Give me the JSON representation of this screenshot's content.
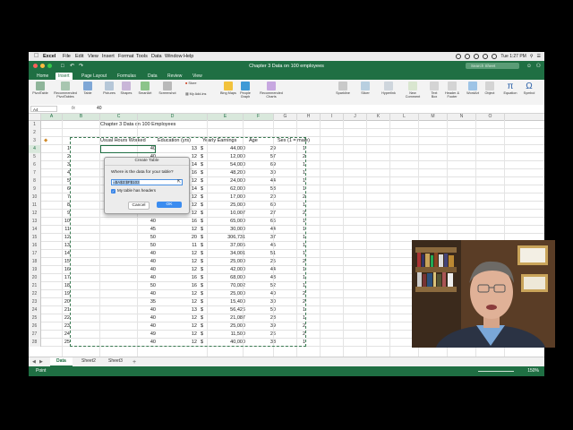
{
  "menubar": {
    "app": "Excel",
    "items": [
      "File",
      "Edit",
      "View",
      "Insert",
      "Format",
      "Tools",
      "Data",
      "Window",
      "Help"
    ],
    "clock": "Tue 1:27 PM"
  },
  "window": {
    "title": "Chapter 3 Data on 100 employees",
    "search_placeholder": "Search Sheet"
  },
  "ribbon_tabs": [
    "Home",
    "Insert",
    "Page Layout",
    "Formulas",
    "Data",
    "Review",
    "View"
  ],
  "ribbon_buttons": [
    "PivotTable",
    "Recommended PivotTables",
    "Table",
    "Pictures",
    "Shapes",
    "SmartArt",
    "Screenshot",
    "Store",
    "My Add-ins",
    "Bing Maps",
    "People Graph",
    "Recommended Charts",
    "Sparkline",
    "Slicer",
    "Hyperlink",
    "New Comment",
    "Text Box",
    "Header & Footer",
    "WordArt",
    "Object",
    "Equation",
    "Symbol"
  ],
  "formula_bar": {
    "name_box": "A4",
    "fx": "fx",
    "value": "40"
  },
  "columns": [
    "A",
    "B",
    "C",
    "D",
    "E",
    "F",
    "G",
    "H",
    "I",
    "J",
    "K",
    "L",
    "M",
    "N",
    "O"
  ],
  "sheet_title": "Chapter 3 Data on 100 Employees",
  "headers": {
    "hours": "Usual Hours Worked",
    "edu": "Education (yrs)",
    "earn": "Yearly Earnings",
    "age": "Age",
    "sex": "Sex (1 = male)"
  },
  "rows": [
    {
      "r": "4",
      "id": "1",
      "hours": "40",
      "edu": "13",
      "earn": "44,000",
      "age": "29",
      "sex": "1"
    },
    {
      "r": "5",
      "id": "2",
      "hours": "40",
      "edu": "12",
      "earn": "12,000",
      "age": "57",
      "sex": "2"
    },
    {
      "r": "6",
      "id": "3",
      "hours": "60",
      "edu": "14",
      "earn": "54,000",
      "age": "69",
      "sex": "1"
    },
    {
      "r": "7",
      "id": "4",
      "hours": "50",
      "edu": "16",
      "earn": "48,200",
      "age": "30",
      "sex": "1"
    },
    {
      "r": "8",
      "id": "5",
      "hours": "40",
      "edu": "12",
      "earn": "24,000",
      "age": "44",
      "sex": "1"
    },
    {
      "r": "9",
      "id": "6",
      "hours": "40",
      "edu": "14",
      "earn": "62,000",
      "age": "53",
      "sex": "1"
    },
    {
      "r": "10",
      "id": "7",
      "hours": "40",
      "edu": "12",
      "earn": "17,000",
      "age": "20",
      "sex": "2"
    },
    {
      "r": "11",
      "id": "8",
      "hours": "40",
      "edu": "12",
      "earn": "25,000",
      "age": "60",
      "sex": "1"
    },
    {
      "r": "12",
      "id": "9",
      "hours": "40",
      "edu": "12",
      "earn": "10,007",
      "age": "27",
      "sex": "2"
    },
    {
      "r": "13",
      "id": "10",
      "hours": "40",
      "edu": "16",
      "earn": "65,000",
      "age": "66",
      "sex": "1"
    },
    {
      "r": "14",
      "id": "11",
      "hours": "45",
      "edu": "12",
      "earn": "30,000",
      "age": "44",
      "sex": "1"
    },
    {
      "r": "15",
      "id": "12",
      "hours": "50",
      "edu": "20",
      "earn": "306,731",
      "age": "37",
      "sex": "1"
    },
    {
      "r": "16",
      "id": "13",
      "hours": "50",
      "edu": "11",
      "earn": "37,005",
      "age": "45",
      "sex": "1"
    },
    {
      "r": "17",
      "id": "14",
      "hours": "40",
      "edu": "12",
      "earn": "34,001",
      "age": "51",
      "sex": "1"
    },
    {
      "r": "18",
      "id": "15",
      "hours": "40",
      "edu": "12",
      "earn": "25,000",
      "age": "25",
      "sex": "2"
    },
    {
      "r": "19",
      "id": "16",
      "hours": "40",
      "edu": "12",
      "earn": "42,000",
      "age": "44",
      "sex": "1"
    },
    {
      "r": "20",
      "id": "17",
      "hours": "40",
      "edu": "16",
      "earn": "68,000",
      "age": "43",
      "sex": "1"
    },
    {
      "r": "21",
      "id": "18",
      "hours": "50",
      "edu": "16",
      "earn": "70,002",
      "age": "52",
      "sex": "1"
    },
    {
      "r": "22",
      "id": "19",
      "hours": "40",
      "edu": "12",
      "earn": "25,000",
      "age": "40",
      "sex": "2"
    },
    {
      "r": "23",
      "id": "20",
      "hours": "35",
      "edu": "12",
      "earn": "15,400",
      "age": "30",
      "sex": "2"
    },
    {
      "r": "24",
      "id": "21",
      "hours": "40",
      "edu": "13",
      "earn": "56,426",
      "age": "50",
      "sex": "1"
    },
    {
      "r": "25",
      "id": "22",
      "hours": "40",
      "edu": "12",
      "earn": "21,087",
      "age": "28",
      "sex": "1"
    },
    {
      "r": "26",
      "id": "23",
      "hours": "40",
      "edu": "12",
      "earn": "25,000",
      "age": "39",
      "sex": "2"
    },
    {
      "r": "27",
      "id": "24",
      "hours": "49",
      "edu": "12",
      "earn": "11,500",
      "age": "26",
      "sex": "2"
    },
    {
      "r": "28",
      "id": "25",
      "hours": "40",
      "edu": "12",
      "earn": "40,000",
      "age": "38",
      "sex": "1"
    }
  ],
  "dollar": "$",
  "dialog": {
    "title": "Create Table",
    "question": "Where is the data for your table?",
    "range": "=$A$3:$F$103",
    "checkbox_label": "My table has headers",
    "cancel": "Cancel",
    "ok": "OK"
  },
  "sheets": [
    "Data",
    "Sheet2",
    "Sheet3"
  ],
  "add_sheet": "+",
  "status": {
    "mode": "Point",
    "zoom": "150%"
  }
}
